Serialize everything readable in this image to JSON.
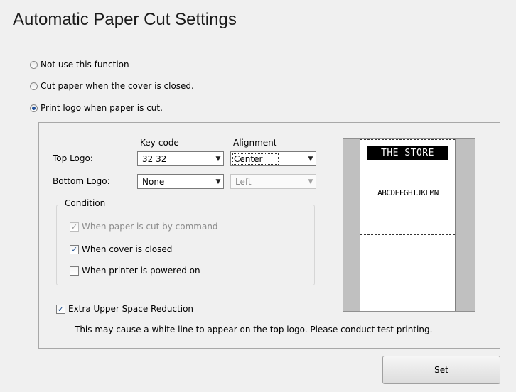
{
  "title": "Automatic Paper Cut Settings",
  "modes": [
    {
      "label": "Not use this function",
      "checked": false
    },
    {
      "label": "Cut paper when the cover is closed.",
      "checked": false
    },
    {
      "label": "Print logo when paper is cut.",
      "checked": true
    }
  ],
  "logo": {
    "keycode_header": "Key-code",
    "alignment_header": "Alignment",
    "top_label": "Top Logo:",
    "top_keycode": "32  32",
    "top_alignment": "Center",
    "bottom_label": "Bottom Logo:",
    "bottom_keycode": "None",
    "bottom_alignment": "Left"
  },
  "condition": {
    "legend": "Condition",
    "items": [
      {
        "label": "When paper is cut by command",
        "checked": true,
        "disabled": true
      },
      {
        "label": "When cover is closed",
        "checked": true,
        "disabled": false
      },
      {
        "label": "When printer is powered on",
        "checked": false,
        "disabled": false
      }
    ]
  },
  "extra": {
    "label": "Extra Upper Space Reduction",
    "checked": true,
    "note": "This may cause a white line to appear on the top logo. Please conduct test printing."
  },
  "preview": {
    "logo_text": "THE STORE",
    "sample_text": "ABCDEFGHIJKLMN"
  },
  "set_button": "Set",
  "icons": {
    "dropdown": "chevron-down-icon",
    "check": "checkmark-icon"
  },
  "colors": {
    "background": "#f0f0f0",
    "radio_dot": "#1f4f9a",
    "logo_bg": "#000000"
  }
}
